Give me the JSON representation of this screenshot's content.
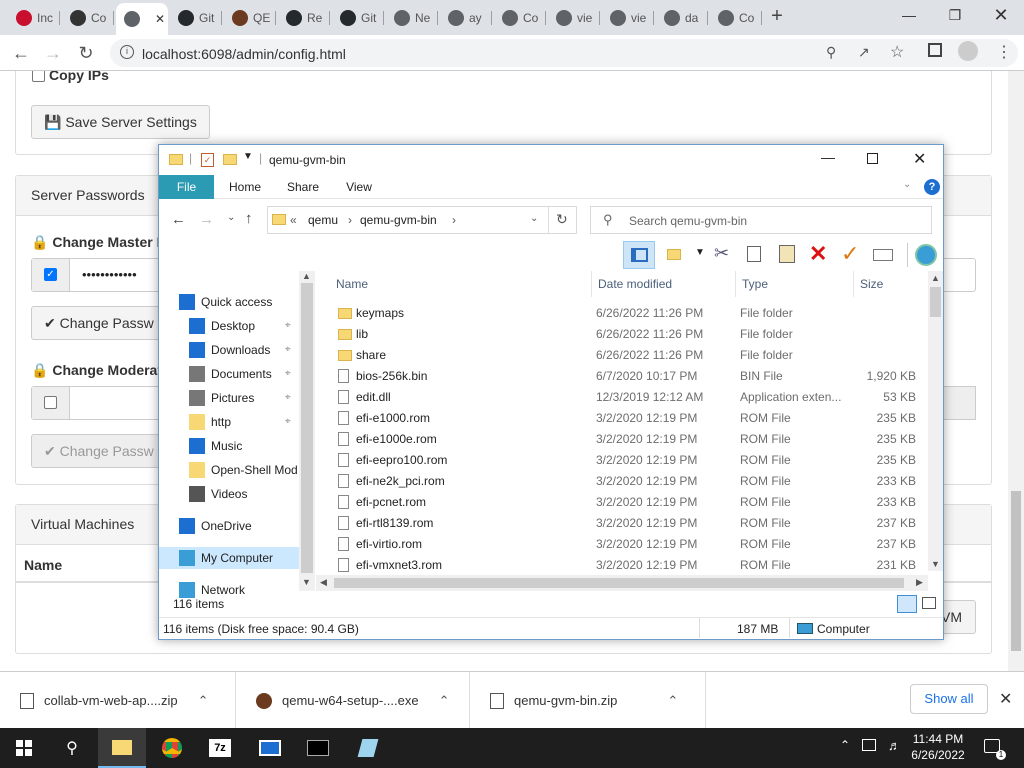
{
  "browser": {
    "tabs": [
      {
        "label": "Inc",
        "icon": "red-a-icon"
      },
      {
        "label": "Co",
        "icon": "user-shield-icon"
      },
      {
        "label": "",
        "icon": "globe-icon"
      },
      {
        "label": "Git",
        "icon": "github-icon"
      },
      {
        "label": "QE",
        "icon": "qemu-icon"
      },
      {
        "label": "Re",
        "icon": "github-icon"
      },
      {
        "label": "Git",
        "icon": "github-icon"
      },
      {
        "label": "Ne",
        "icon": "globe-icon"
      },
      {
        "label": "ay",
        "icon": "globe-icon"
      },
      {
        "label": "Co",
        "icon": "globe-icon"
      },
      {
        "label": "vie",
        "icon": "globe-icon"
      },
      {
        "label": "vie",
        "icon": "globe-icon"
      },
      {
        "label": "da",
        "icon": "globe-icon"
      },
      {
        "label": "Co",
        "icon": "globe-icon"
      }
    ],
    "url": "localhost:6098/admin/config.html"
  },
  "page": {
    "copy_ips": "Copy IPs",
    "save_server": "Save Server Settings",
    "server_passwords": "Server Passwords",
    "change_master": "Change Master F",
    "master_password_mask": "••••••••••••",
    "change_password_btn": "Change Passw",
    "change_moderator": "Change Moderat",
    "change_password_btn2": "Change Passw",
    "virtual_machines": "Virtual Machines",
    "col_name": "Name",
    "vm_btn": "VM"
  },
  "explorer": {
    "title": "qemu-gvm-bin",
    "ribbon_tabs": [
      "File",
      "Home",
      "Share",
      "View"
    ],
    "breadcrumb": [
      "«",
      "qemu",
      "›",
      "qemu-gvm-bin",
      "›"
    ],
    "search_placeholder": "Search qemu-gvm-bin",
    "nav": [
      {
        "label": "Quick access",
        "icon": "star-icon"
      },
      {
        "label": "Desktop",
        "icon": "desktop-icon"
      },
      {
        "label": "Downloads",
        "icon": "download-icon"
      },
      {
        "label": "Documents",
        "icon": "documents-icon"
      },
      {
        "label": "Pictures",
        "icon": "pictures-icon"
      },
      {
        "label": "http",
        "icon": "folder-icon"
      },
      {
        "label": "Music",
        "icon": "music-icon"
      },
      {
        "label": "Open-Shell Mod",
        "icon": "folder-icon"
      },
      {
        "label": "Videos",
        "icon": "videos-icon"
      },
      {
        "label": "OneDrive",
        "icon": "cloud-icon"
      },
      {
        "label": "My Computer",
        "icon": "computer-icon"
      },
      {
        "label": "Network",
        "icon": "network-icon"
      }
    ],
    "columns": [
      "Name",
      "Date modified",
      "Type",
      "Size"
    ],
    "files": [
      {
        "name": "keymaps",
        "date": "6/26/2022 11:26 PM",
        "type": "File folder",
        "size": "",
        "folder": true
      },
      {
        "name": "lib",
        "date": "6/26/2022 11:26 PM",
        "type": "File folder",
        "size": "",
        "folder": true
      },
      {
        "name": "share",
        "date": "6/26/2022 11:26 PM",
        "type": "File folder",
        "size": "",
        "folder": true
      },
      {
        "name": "bios-256k.bin",
        "date": "6/7/2020 10:17 PM",
        "type": "BIN File",
        "size": "1,920 KB",
        "folder": false
      },
      {
        "name": "edit.dll",
        "date": "12/3/2019 12:12 AM",
        "type": "Application exten...",
        "size": "53 KB",
        "folder": false
      },
      {
        "name": "efi-e1000.rom",
        "date": "3/2/2020 12:19 PM",
        "type": "ROM File",
        "size": "235 KB",
        "folder": false
      },
      {
        "name": "efi-e1000e.rom",
        "date": "3/2/2020 12:19 PM",
        "type": "ROM File",
        "size": "235 KB",
        "folder": false
      },
      {
        "name": "efi-eepro100.rom",
        "date": "3/2/2020 12:19 PM",
        "type": "ROM File",
        "size": "235 KB",
        "folder": false
      },
      {
        "name": "efi-ne2k_pci.rom",
        "date": "3/2/2020 12:19 PM",
        "type": "ROM File",
        "size": "233 KB",
        "folder": false
      },
      {
        "name": "efi-pcnet.rom",
        "date": "3/2/2020 12:19 PM",
        "type": "ROM File",
        "size": "233 KB",
        "folder": false
      },
      {
        "name": "efi-rtl8139.rom",
        "date": "3/2/2020 12:19 PM",
        "type": "ROM File",
        "size": "237 KB",
        "folder": false
      },
      {
        "name": "efi-virtio.rom",
        "date": "3/2/2020 12:19 PM",
        "type": "ROM File",
        "size": "237 KB",
        "folder": false
      },
      {
        "name": "efi-vmxnet3.rom",
        "date": "3/2/2020 12:19 PM",
        "type": "ROM File",
        "size": "231 KB",
        "folder": false
      }
    ],
    "item_count": "116 items",
    "status_left": "116 items (Disk free space: 90.4 GB)",
    "status_size": "187 MB",
    "status_location": "Computer"
  },
  "downloads": {
    "items": [
      {
        "name": "collab-vm-web-ap....zip"
      },
      {
        "name": "qemu-w64-setup-....exe"
      },
      {
        "name": "qemu-gvm-bin.zip"
      }
    ],
    "show_all": "Show all"
  },
  "taskbar": {
    "time": "11:44 PM",
    "date": "6/26/2022"
  }
}
